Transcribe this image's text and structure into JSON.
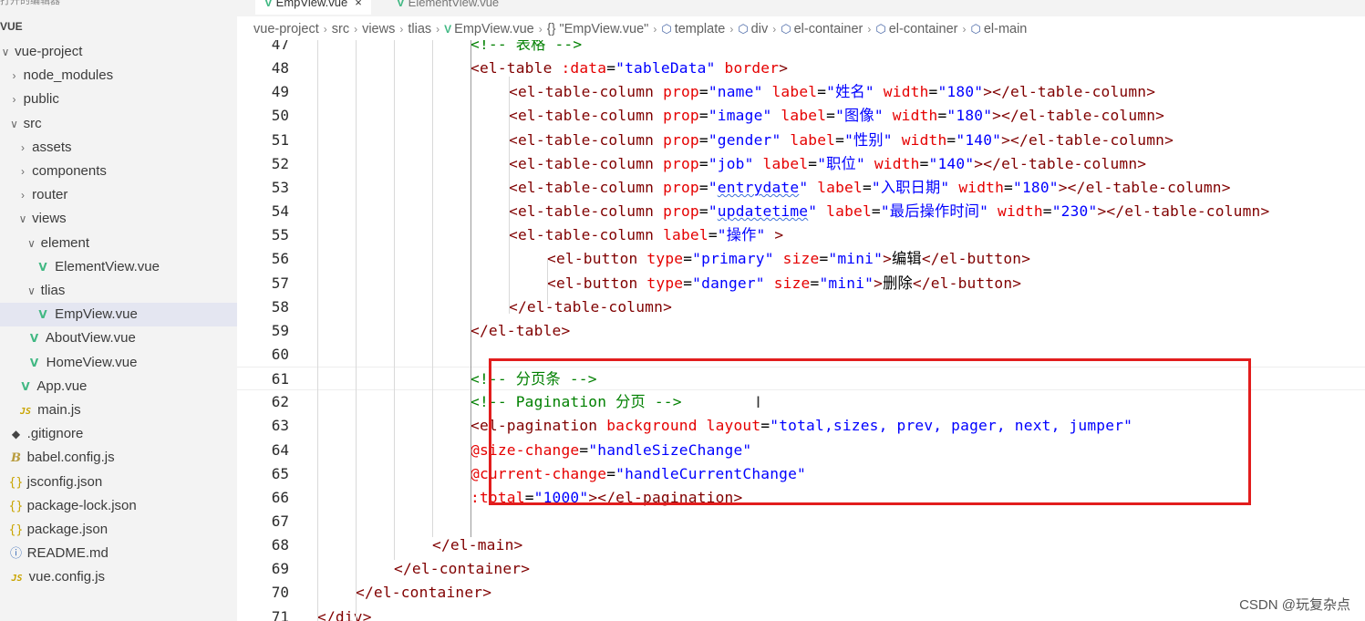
{
  "sidebar": {
    "top_cut": "打开的编辑器",
    "section_title": "VUE",
    "items": [
      {
        "label": "vue-project",
        "twisty": "∨",
        "icon": "",
        "indent": 0
      },
      {
        "label": "node_modules",
        "twisty": "›",
        "icon": "",
        "indent": 1
      },
      {
        "label": "public",
        "twisty": "›",
        "icon": "",
        "indent": 1
      },
      {
        "label": "src",
        "twisty": "∨",
        "icon": "",
        "indent": 1
      },
      {
        "label": "assets",
        "twisty": "›",
        "icon": "",
        "indent": 2
      },
      {
        "label": "components",
        "twisty": "›",
        "icon": "",
        "indent": 2
      },
      {
        "label": "router",
        "twisty": "›",
        "icon": "",
        "indent": 2
      },
      {
        "label": "views",
        "twisty": "∨",
        "icon": "",
        "indent": 2
      },
      {
        "label": "element",
        "twisty": "∨",
        "icon": "",
        "indent": 3
      },
      {
        "label": "ElementView.vue",
        "twisty": "",
        "icon": "vue",
        "indent": 4
      },
      {
        "label": "tlias",
        "twisty": "∨",
        "icon": "",
        "indent": 3
      },
      {
        "label": "EmpView.vue",
        "twisty": "",
        "icon": "vue",
        "indent": 4,
        "selected": true
      },
      {
        "label": "AboutView.vue",
        "twisty": "",
        "icon": "vue",
        "indent": 3
      },
      {
        "label": "HomeView.vue",
        "twisty": "",
        "icon": "vue",
        "indent": 3
      },
      {
        "label": "App.vue",
        "twisty": "",
        "icon": "vue",
        "indent": 2
      },
      {
        "label": "main.js",
        "twisty": "",
        "icon": "js",
        "indent": 2
      },
      {
        "label": ".gitignore",
        "twisty": "",
        "icon": "git",
        "indent": 1
      },
      {
        "label": "babel.config.js",
        "twisty": "",
        "icon": "babel",
        "indent": 1
      },
      {
        "label": "jsconfig.json",
        "twisty": "",
        "icon": "json",
        "indent": 1
      },
      {
        "label": "package-lock.json",
        "twisty": "",
        "icon": "json",
        "indent": 1
      },
      {
        "label": "package.json",
        "twisty": "",
        "icon": "json",
        "indent": 1
      },
      {
        "label": "README.md",
        "twisty": "",
        "icon": "info",
        "indent": 1
      },
      {
        "label": "vue.config.js",
        "twisty": "",
        "icon": "js",
        "indent": 1
      }
    ]
  },
  "tabs": [
    {
      "label": "EmpView.vue",
      "close": "×",
      "active": true
    },
    {
      "label": "ElementView.vue",
      "close": "",
      "active": false
    }
  ],
  "breadcrumb": [
    {
      "label": "vue-project",
      "icon": ""
    },
    {
      "label": "src",
      "icon": ""
    },
    {
      "label": "views",
      "icon": ""
    },
    {
      "label": "tlias",
      "icon": ""
    },
    {
      "label": "EmpView.vue",
      "icon": "vue"
    },
    {
      "label": "\"EmpView.vue\"",
      "icon": "braces"
    },
    {
      "label": "template",
      "icon": "cube"
    },
    {
      "label": "div",
      "icon": "cube"
    },
    {
      "label": "el-container",
      "icon": "cube"
    },
    {
      "label": "el-container",
      "icon": "cube"
    },
    {
      "label": "el-main",
      "icon": "cube"
    }
  ],
  "code_lines": [
    {
      "n": "47",
      "indent": 3,
      "tokens": [
        [
          "c",
          "<!-- 表格 -->"
        ]
      ]
    },
    {
      "n": "48",
      "indent": 3,
      "tokens": [
        [
          "t",
          "<el-table"
        ],
        [
          "p",
          " "
        ],
        [
          "a",
          ":data"
        ],
        [
          "p",
          "="
        ],
        [
          "s",
          "\"tableData\""
        ],
        [
          "p",
          " "
        ],
        [
          "a",
          "border"
        ],
        [
          "t",
          ">"
        ]
      ]
    },
    {
      "n": "49",
      "indent": 4,
      "tokens": [
        [
          "t",
          "<el-table-column"
        ],
        [
          "p",
          " "
        ],
        [
          "a",
          "prop"
        ],
        [
          "p",
          "="
        ],
        [
          "s",
          "\"name\""
        ],
        [
          "p",
          " "
        ],
        [
          "a",
          "label"
        ],
        [
          "p",
          "="
        ],
        [
          "s",
          "\"姓名\""
        ],
        [
          "p",
          " "
        ],
        [
          "a",
          "width"
        ],
        [
          "p",
          "="
        ],
        [
          "s",
          "\"180\""
        ],
        [
          "t",
          "></el-table-column>"
        ]
      ]
    },
    {
      "n": "50",
      "indent": 4,
      "tokens": [
        [
          "t",
          "<el-table-column"
        ],
        [
          "p",
          " "
        ],
        [
          "a",
          "prop"
        ],
        [
          "p",
          "="
        ],
        [
          "s",
          "\"image\""
        ],
        [
          "p",
          " "
        ],
        [
          "a",
          "label"
        ],
        [
          "p",
          "="
        ],
        [
          "s",
          "\"图像\""
        ],
        [
          "p",
          " "
        ],
        [
          "a",
          "width"
        ],
        [
          "p",
          "="
        ],
        [
          "s",
          "\"180\""
        ],
        [
          "t",
          "></el-table-column>"
        ]
      ]
    },
    {
      "n": "51",
      "indent": 4,
      "tokens": [
        [
          "t",
          "<el-table-column"
        ],
        [
          "p",
          " "
        ],
        [
          "a",
          "prop"
        ],
        [
          "p",
          "="
        ],
        [
          "s",
          "\"gender\""
        ],
        [
          "p",
          " "
        ],
        [
          "a",
          "label"
        ],
        [
          "p",
          "="
        ],
        [
          "s",
          "\"性别\""
        ],
        [
          "p",
          " "
        ],
        [
          "a",
          "width"
        ],
        [
          "p",
          "="
        ],
        [
          "s",
          "\"140\""
        ],
        [
          "t",
          "></el-table-column>"
        ]
      ]
    },
    {
      "n": "52",
      "indent": 4,
      "tokens": [
        [
          "t",
          "<el-table-column"
        ],
        [
          "p",
          " "
        ],
        [
          "a",
          "prop"
        ],
        [
          "p",
          "="
        ],
        [
          "s",
          "\"job\""
        ],
        [
          "p",
          " "
        ],
        [
          "a",
          "label"
        ],
        [
          "p",
          "="
        ],
        [
          "s",
          "\"职位\""
        ],
        [
          "p",
          " "
        ],
        [
          "a",
          "width"
        ],
        [
          "p",
          "="
        ],
        [
          "s",
          "\"140\""
        ],
        [
          "t",
          "></el-table-column>"
        ]
      ]
    },
    {
      "n": "53",
      "indent": 4,
      "tokens": [
        [
          "t",
          "<el-table-column"
        ],
        [
          "p",
          " "
        ],
        [
          "a",
          "prop"
        ],
        [
          "p",
          "="
        ],
        [
          "s",
          "\""
        ],
        [
          "sq",
          "entrydate"
        ],
        [
          "s",
          "\""
        ],
        [
          "p",
          " "
        ],
        [
          "a",
          "label"
        ],
        [
          "p",
          "="
        ],
        [
          "s",
          "\"入职日期\""
        ],
        [
          "p",
          " "
        ],
        [
          "a",
          "width"
        ],
        [
          "p",
          "="
        ],
        [
          "s",
          "\"180\""
        ],
        [
          "t",
          "></el-table-column>"
        ]
      ]
    },
    {
      "n": "54",
      "indent": 4,
      "tokens": [
        [
          "t",
          "<el-table-column"
        ],
        [
          "p",
          " "
        ],
        [
          "a",
          "prop"
        ],
        [
          "p",
          "="
        ],
        [
          "s",
          "\""
        ],
        [
          "sq",
          "updatetime"
        ],
        [
          "s",
          "\""
        ],
        [
          "p",
          " "
        ],
        [
          "a",
          "label"
        ],
        [
          "p",
          "="
        ],
        [
          "s",
          "\"最后操作时间\""
        ],
        [
          "p",
          " "
        ],
        [
          "a",
          "width"
        ],
        [
          "p",
          "="
        ],
        [
          "s",
          "\"230\""
        ],
        [
          "t",
          "></el-table-column>"
        ]
      ]
    },
    {
      "n": "55",
      "indent": 4,
      "tokens": [
        [
          "t",
          "<el-table-column"
        ],
        [
          "p",
          " "
        ],
        [
          "a",
          "label"
        ],
        [
          "p",
          "="
        ],
        [
          "s",
          "\"操作\""
        ],
        [
          "p",
          " "
        ],
        [
          "t",
          ">"
        ]
      ]
    },
    {
      "n": "56",
      "indent": 5,
      "tokens": [
        [
          "t",
          "<el-button"
        ],
        [
          "p",
          " "
        ],
        [
          "a",
          "type"
        ],
        [
          "p",
          "="
        ],
        [
          "s",
          "\"primary\""
        ],
        [
          "p",
          " "
        ],
        [
          "a",
          "size"
        ],
        [
          "p",
          "="
        ],
        [
          "s",
          "\"mini\""
        ],
        [
          "t",
          ">"
        ],
        [
          "p",
          "编辑"
        ],
        [
          "t",
          "</el-button>"
        ]
      ]
    },
    {
      "n": "57",
      "indent": 5,
      "tokens": [
        [
          "t",
          "<el-button"
        ],
        [
          "p",
          " "
        ],
        [
          "a",
          "type"
        ],
        [
          "p",
          "="
        ],
        [
          "s",
          "\"danger\""
        ],
        [
          "p",
          " "
        ],
        [
          "a",
          "size"
        ],
        [
          "p",
          "="
        ],
        [
          "s",
          "\"mini\""
        ],
        [
          "t",
          ">"
        ],
        [
          "p",
          "删除"
        ],
        [
          "t",
          "</el-button>"
        ]
      ]
    },
    {
      "n": "58",
      "indent": 4,
      "tokens": [
        [
          "t",
          "</el-table-column>"
        ]
      ]
    },
    {
      "n": "59",
      "indent": 3,
      "tokens": [
        [
          "t",
          "</el-table>"
        ]
      ]
    },
    {
      "n": "60",
      "indent": 3,
      "tokens": []
    },
    {
      "n": "61",
      "indent": 3,
      "current": true,
      "tokens": [
        [
          "c",
          "<!-- 分页条 -->"
        ]
      ]
    },
    {
      "n": "62",
      "indent": 3,
      "tokens": [
        [
          "c",
          "<!-- Pagination 分页 -->"
        ]
      ]
    },
    {
      "n": "63",
      "indent": 3,
      "tokens": [
        [
          "t",
          "<el-pagination"
        ],
        [
          "p",
          " "
        ],
        [
          "a",
          "background"
        ],
        [
          "p",
          " "
        ],
        [
          "a",
          "layout"
        ],
        [
          "p",
          "="
        ],
        [
          "s",
          "\"total,sizes, prev, pager, next, jumper\""
        ]
      ]
    },
    {
      "n": "64",
      "indent": 3,
      "tokens": [
        [
          "a",
          "@size-change"
        ],
        [
          "p",
          "="
        ],
        [
          "s",
          "\"handleSizeChange\""
        ]
      ]
    },
    {
      "n": "65",
      "indent": 3,
      "tokens": [
        [
          "a",
          "@current-change"
        ],
        [
          "p",
          "="
        ],
        [
          "s",
          "\"handleCurrentChange\""
        ]
      ]
    },
    {
      "n": "66",
      "indent": 3,
      "tokens": [
        [
          "a",
          ":total"
        ],
        [
          "p",
          "="
        ],
        [
          "s",
          "\"1000\""
        ],
        [
          "t",
          "></el-pagination>"
        ]
      ]
    },
    {
      "n": "67",
      "indent": 3,
      "tokens": []
    },
    {
      "n": "68",
      "indent": 2,
      "tokens": [
        [
          "t",
          "</el-main>"
        ]
      ]
    },
    {
      "n": "69",
      "indent": 1,
      "tokens": [
        [
          "t",
          "</el-container>"
        ]
      ]
    },
    {
      "n": "70",
      "indent": 0,
      "tokens": [
        [
          "t",
          "</el-container>"
        ]
      ]
    },
    {
      "n": "71",
      "indent": -1,
      "tokens": [
        [
          "t",
          "</div>"
        ]
      ]
    }
  ],
  "cursor_glyph": "I",
  "watermark": "CSDN @玩复杂点",
  "colors": {
    "tag": "#800000",
    "attribute": "#e50000",
    "string": "#0000ff",
    "comment": "#008000",
    "highlight_box": "#e21d1d",
    "vue_logo": "#41b883"
  }
}
